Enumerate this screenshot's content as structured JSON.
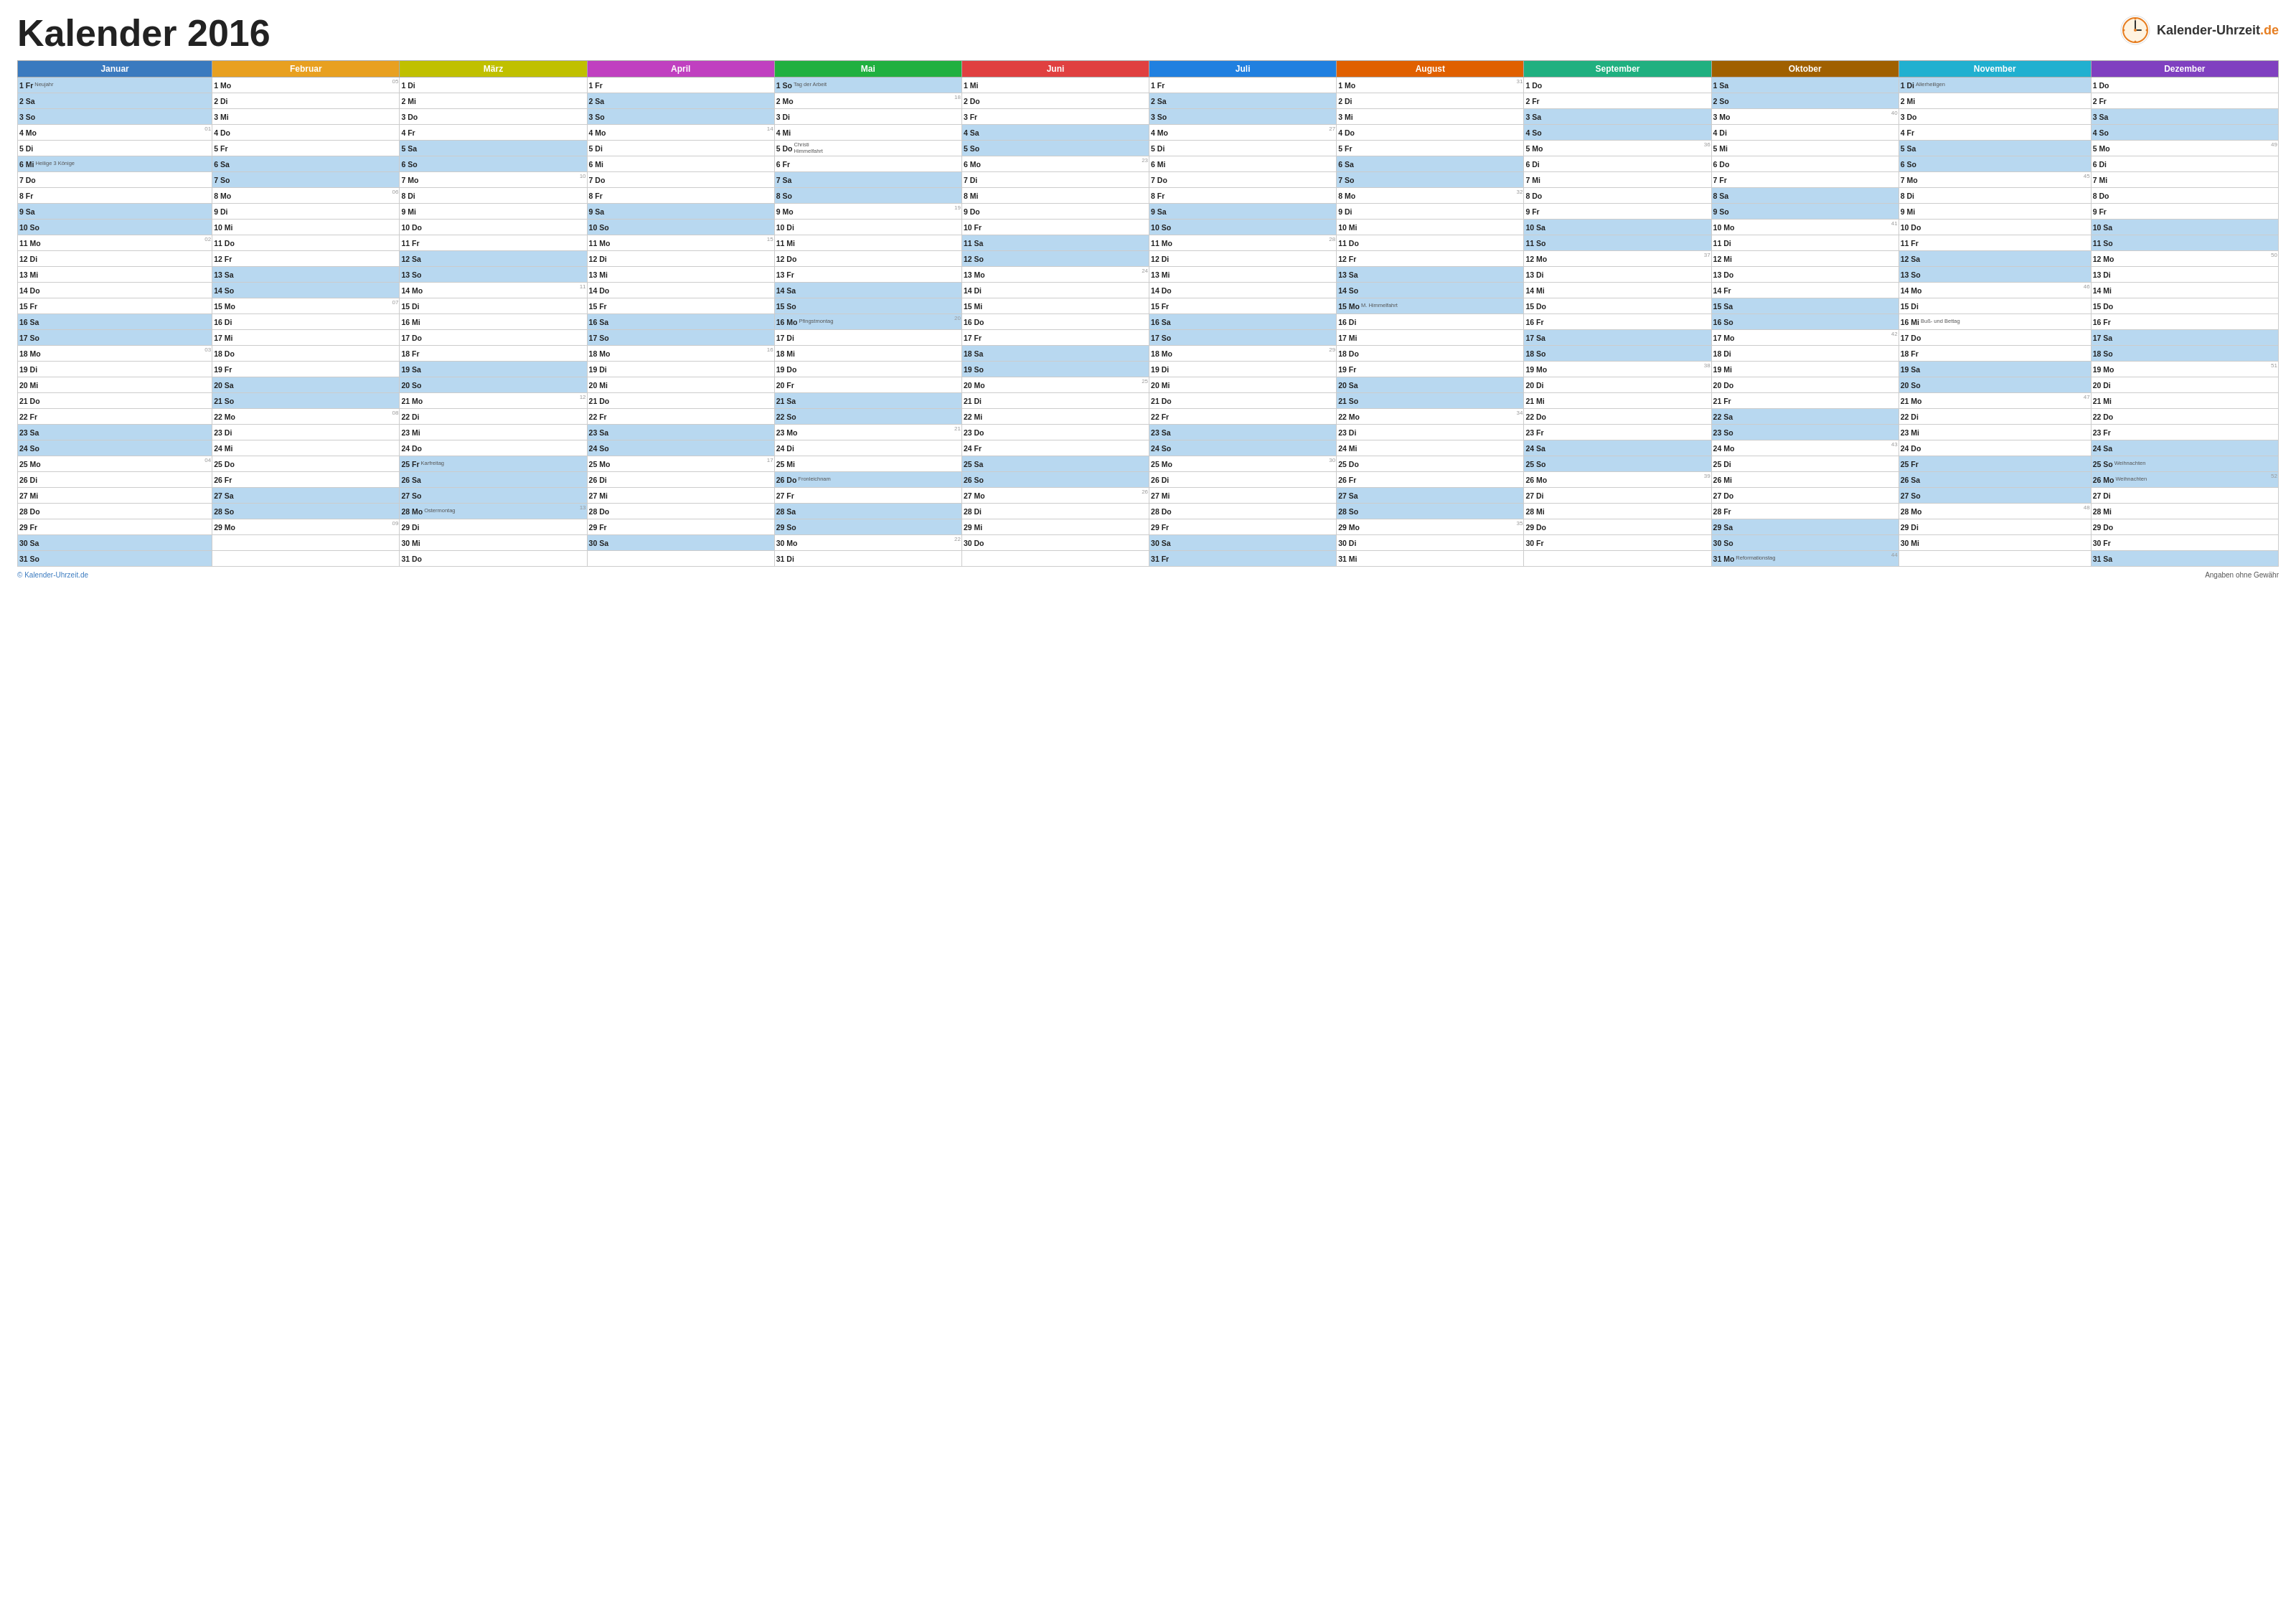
{
  "title": "Kalender 2016",
  "logo": {
    "text": "Kalender-Uhrzeit",
    "domain": ".de"
  },
  "footer": {
    "left": "© Kalender-Uhrzeit.de",
    "right": "Angaben ohne Gewähr"
  },
  "months": [
    "Januar",
    "Februar",
    "März",
    "April",
    "Mai",
    "Juni",
    "Juli",
    "August",
    "September",
    "Oktober",
    "November",
    "Dezember"
  ]
}
